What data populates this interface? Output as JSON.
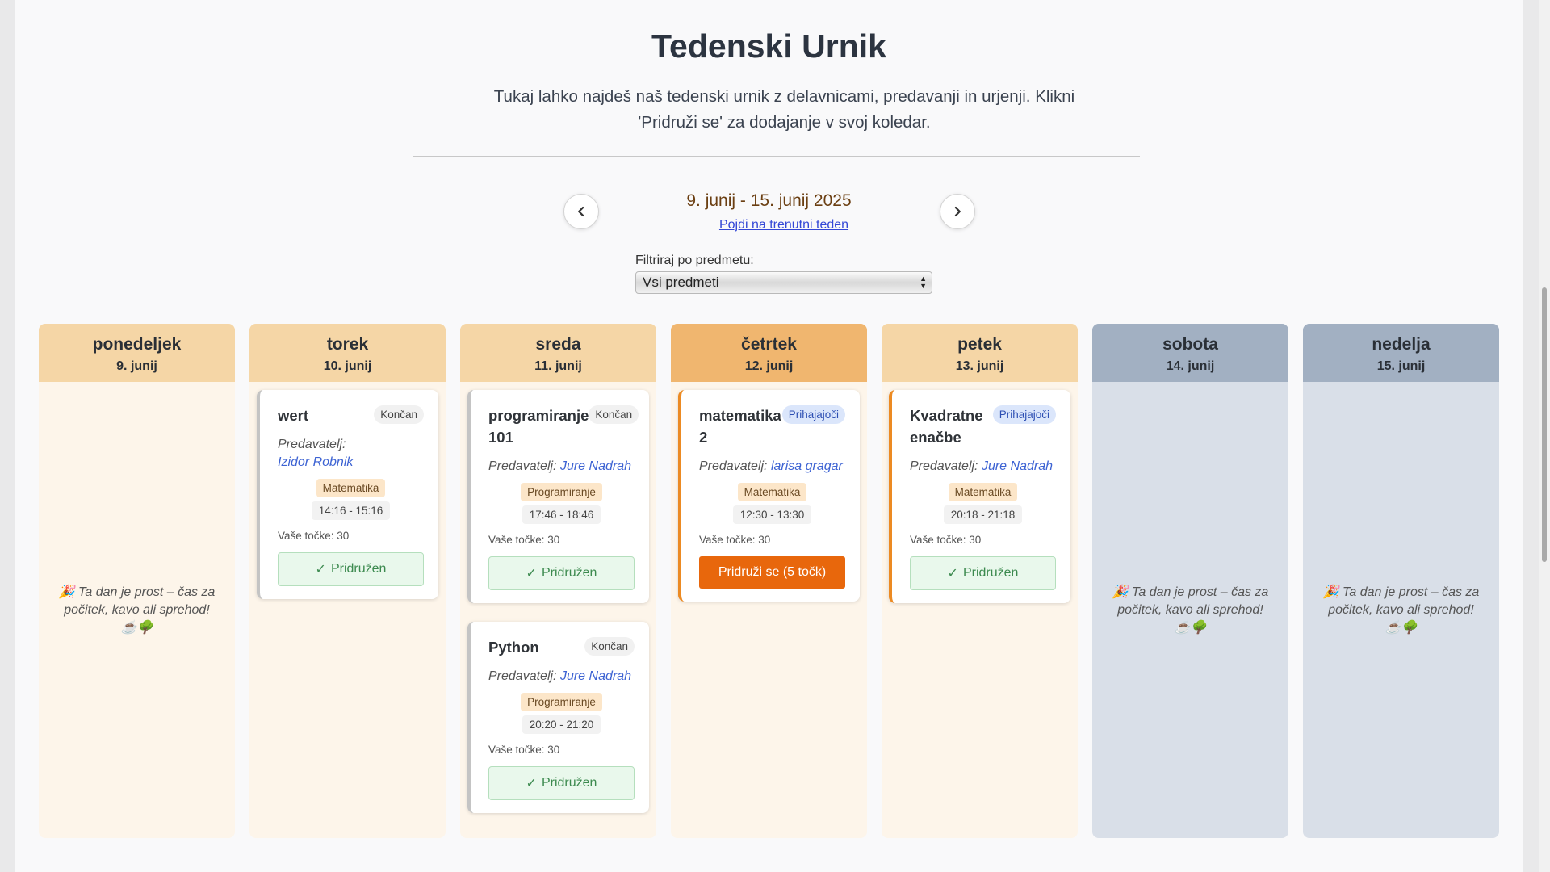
{
  "header": {
    "title": "Tedenski Urnik",
    "subtitle": "Tukaj lahko najdeš naš tedenski urnik z delavnicami, predavanji in urjenji. Klikni 'Pridruži se' za dodajanje v svoj koledar."
  },
  "week": {
    "range": "9. junij - 15. junij 2025",
    "current_link": "Pojdi na trenutni teden"
  },
  "filter": {
    "label": "Filtriraj po predmetu:",
    "selected": "Vsi predmeti"
  },
  "lecturer_prefix": "Predavatelj:",
  "points_prefix": "Vaše točke: ",
  "free_day_text": "🎉 Ta dan je prost – čas za počitek, kavo ali sprehod! ☕🌳",
  "days": [
    {
      "name": "ponedeljek",
      "date": "9. junij"
    },
    {
      "name": "torek",
      "date": "10. junij"
    },
    {
      "name": "sreda",
      "date": "11. junij"
    },
    {
      "name": "četrtek",
      "date": "12. junij"
    },
    {
      "name": "petek",
      "date": "13. junij"
    },
    {
      "name": "sobota",
      "date": "14. junij"
    },
    {
      "name": "nedelja",
      "date": "15. junij"
    }
  ],
  "events": {
    "torek_0": {
      "title": "wert",
      "status": "Končan",
      "lecturer": "Izidor Robnik",
      "subject": "Matematika",
      "time": "14:16 - 15:16",
      "points": "30",
      "action": "Pridružen"
    },
    "sreda_0": {
      "title": "programiranje 101",
      "status": "Končan",
      "lecturer": "Jure Nadrah",
      "subject": "Programiranje",
      "time": "17:46 - 18:46",
      "points": "30",
      "action": "Pridružen"
    },
    "sreda_1": {
      "title": "Python",
      "status": "Končan",
      "lecturer": "Jure Nadrah",
      "subject": "Programiranje",
      "time": "20:20 - 21:20",
      "points": "30",
      "action": "Pridružen"
    },
    "cetrtek_0": {
      "title": "matematika 2",
      "status": "Prihajajoči",
      "lecturer": "larisa gragar",
      "subject": "Matematika",
      "time": "12:30 - 13:30",
      "points": "30",
      "action": "Pridruži se (5 točk)"
    },
    "petek_0": {
      "title": "Kvadratne enačbe",
      "status": "Prihajajoči",
      "lecturer": "Jure Nadrah",
      "subject": "Matematika",
      "time": "20:18 - 21:18",
      "points": "30",
      "action": "Pridružen"
    }
  }
}
